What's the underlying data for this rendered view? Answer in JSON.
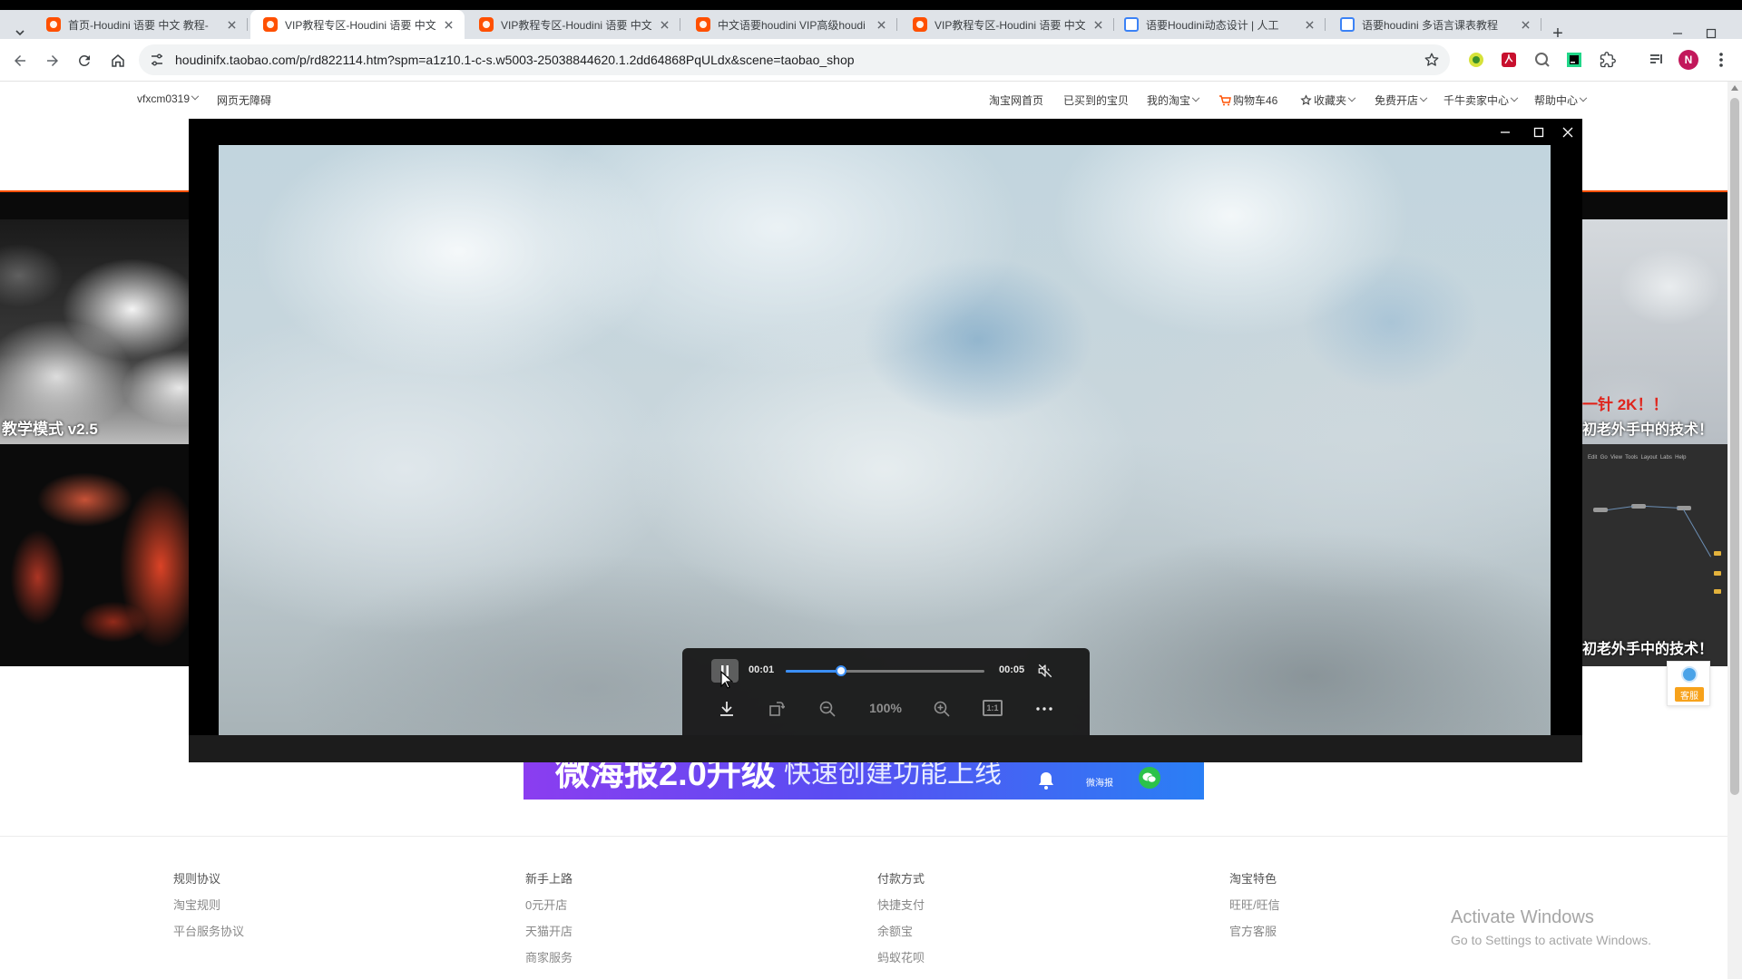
{
  "browser": {
    "tabs": [
      {
        "title": "首页-Houdini 语要 中文 教程-",
        "favicon": "taobao-icon",
        "active": false
      },
      {
        "title": "VIP教程专区-Houdini 语要 中文",
        "favicon": "taobao-icon",
        "active": true
      },
      {
        "title": "VIP教程专区-Houdini 语要 中文",
        "favicon": "taobao-icon",
        "active": false
      },
      {
        "title": "中文语要houdini VIP高级houdi",
        "favicon": "taobao-icon",
        "active": false
      },
      {
        "title": "VIP教程专区-Houdini 语要 中文",
        "favicon": "taobao-icon",
        "active": false
      },
      {
        "title": "语要Houdini动态设计 | 人工",
        "favicon": "document-icon",
        "active": false
      },
      {
        "title": "语要houdini 多语言课表教程",
        "favicon": "document-icon",
        "active": false
      }
    ],
    "new_tab_label": "+",
    "url": "houdinifx.taobao.com/p/rd822114.htm?spm=a1z10.1-c-s.w5003-25038844620.1.2dd64868PqULdx&scene=taobao_shop",
    "profile_initial": "N"
  },
  "taobao_nav": {
    "user": "vfxcm0319",
    "accessibility": "网页无障碍",
    "home": "淘宝网首页",
    "bought": "已买到的宝贝",
    "my_taobao": "我的淘宝",
    "cart": "购物车46",
    "favorites": "收藏夹",
    "open_shop": "免费开店",
    "seller_center": "千牛卖家中心",
    "help": "帮助中心"
  },
  "background": {
    "left_caption": "教学模式 v2.5",
    "right_headline": "一针 2K！！",
    "right_caption": "初老外手中的技术！",
    "right_caption_bottom": "初老外手中的技术！",
    "houdini_menu": "Edit  Go  View  Tools  Layout  Labs  Help"
  },
  "viewer": {
    "current_time": "00:01",
    "duration": "00:05",
    "progress": 0.28,
    "zoom": "100%",
    "actual_size_label": "1:1",
    "muted": true
  },
  "banner": {
    "headline": "微海报2.0升级",
    "subline": "快速创建功能上线",
    "badge": "微海报"
  },
  "footer": {
    "columns": [
      {
        "heading": "规则协议",
        "links": [
          "淘宝规则",
          "平台服务协议"
        ]
      },
      {
        "heading": "新手上路",
        "links": [
          "0元开店",
          "天猫开店",
          "商家服务"
        ]
      },
      {
        "heading": "付款方式",
        "links": [
          "快捷支付",
          "余额宝",
          "蚂蚁花呗"
        ]
      },
      {
        "heading": "淘宝特色",
        "links": [
          "旺旺/旺信",
          "官方客服"
        ]
      }
    ]
  },
  "service": {
    "label": "客服"
  },
  "watermark": {
    "title": "Activate Windows",
    "subtitle": "Go to Settings to activate Windows."
  },
  "colors": {
    "taobao_orange": "#ff5000",
    "progress_blue": "#3b8ff6",
    "banner_purple": "#8b3df0",
    "banner_blue": "#2a7ff5",
    "profile_magenta": "#c2185b"
  }
}
